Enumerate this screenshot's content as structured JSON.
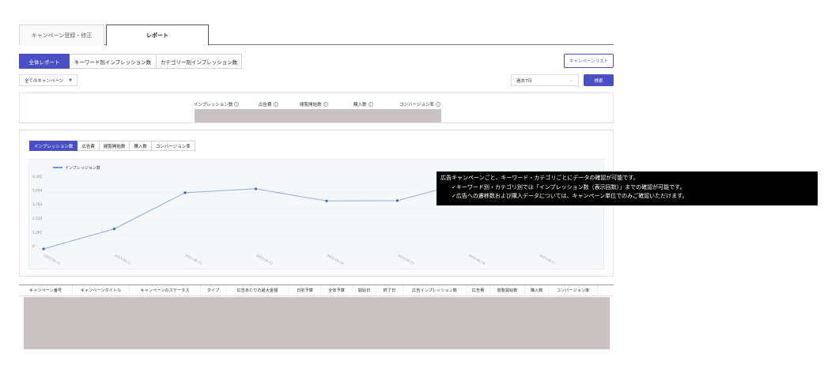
{
  "top_tabs": [
    {
      "label": "キャンペーン登録・修正"
    },
    {
      "label": "レポート"
    }
  ],
  "sub_tabs": [
    {
      "label": "全体レポート"
    },
    {
      "label": "キーワード別インプレッション数"
    },
    {
      "label": "カテゴリー別インプレッション数"
    }
  ],
  "campaign_list_button": "キャンペーンリスト",
  "campaign_select": {
    "value": "全てのキャンペーン"
  },
  "period_select": {
    "value": "過去7日"
  },
  "search_button": "検索",
  "summary_labels": [
    "インプレッション数",
    "広告費",
    "閲覧開始数",
    "購入数",
    "コンバージョン率"
  ],
  "metric_tabs": [
    "インプレッション数",
    "広告費",
    "閲覧開始数",
    "購入数",
    "コンバージョン率"
  ],
  "chart_data": {
    "type": "line",
    "series": [
      {
        "name": "インプレッション数",
        "values": [
          0,
          1820,
          5100,
          5450,
          4350,
          4380,
          6100
        ]
      }
    ],
    "x": [
      "2023-06-10",
      "2023-06-11",
      "2023-06-12",
      "2023-06-13",
      "2023-06-14",
      "2023-06-15",
      "2023-06-16",
      "2023-06-17"
    ],
    "y_ticks": [
      "6,305",
      "5,044",
      "3,783",
      "2,522",
      "1,261",
      "0"
    ],
    "ylim": [
      0,
      6305
    ],
    "grid": true,
    "legend": "top-left",
    "color": "#8aaee0"
  },
  "table_headers": [
    "キャンペーン番号",
    "キャンペーンタイトル",
    "キャンペーンのステータス",
    "タイプ",
    "広告あたりの最大金額",
    "日別予算",
    "全体予算",
    "開始日",
    "終了日",
    "広告インプレッション数",
    "広告費",
    "閲覧開始数",
    "購入数",
    "コンバージョン率"
  ],
  "tooltip": {
    "line1": "広告キャンペーンごと、キーワード・カテゴリごとにデータの確認が可能です。",
    "line2": "✓キーワード別・カテゴリ別では「インプレッション数（表示回数）」までの確認が可能です。",
    "line3": "✓広告への遷移数および購入データについては、キャンペーン単位でのみご確認いただけます。"
  },
  "colors": {
    "accent": "#4a4fc4",
    "masked": "#c9c3c4"
  }
}
